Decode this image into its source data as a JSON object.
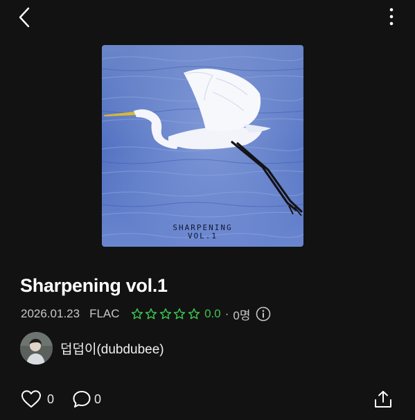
{
  "topbar": {
    "back_icon": "chevron-left-icon",
    "more_icon": "more-vertical-icon"
  },
  "album": {
    "cover_line1": "SHARPENING",
    "cover_line2": "VOL.1",
    "title": "Sharpening vol.1",
    "release_date": "2026.01.23",
    "format": "FLAC",
    "rating": "0.0",
    "rating_separator": "·",
    "rater_count": "0명",
    "star_count": 5,
    "star_color": "#3ec24f"
  },
  "artist": {
    "name": "덥덥이(dubdubee)"
  },
  "actions": {
    "like_icon": "heart-icon",
    "like_count": "0",
    "comment_icon": "comment-icon",
    "comment_count": "0",
    "share_icon": "share-icon"
  }
}
